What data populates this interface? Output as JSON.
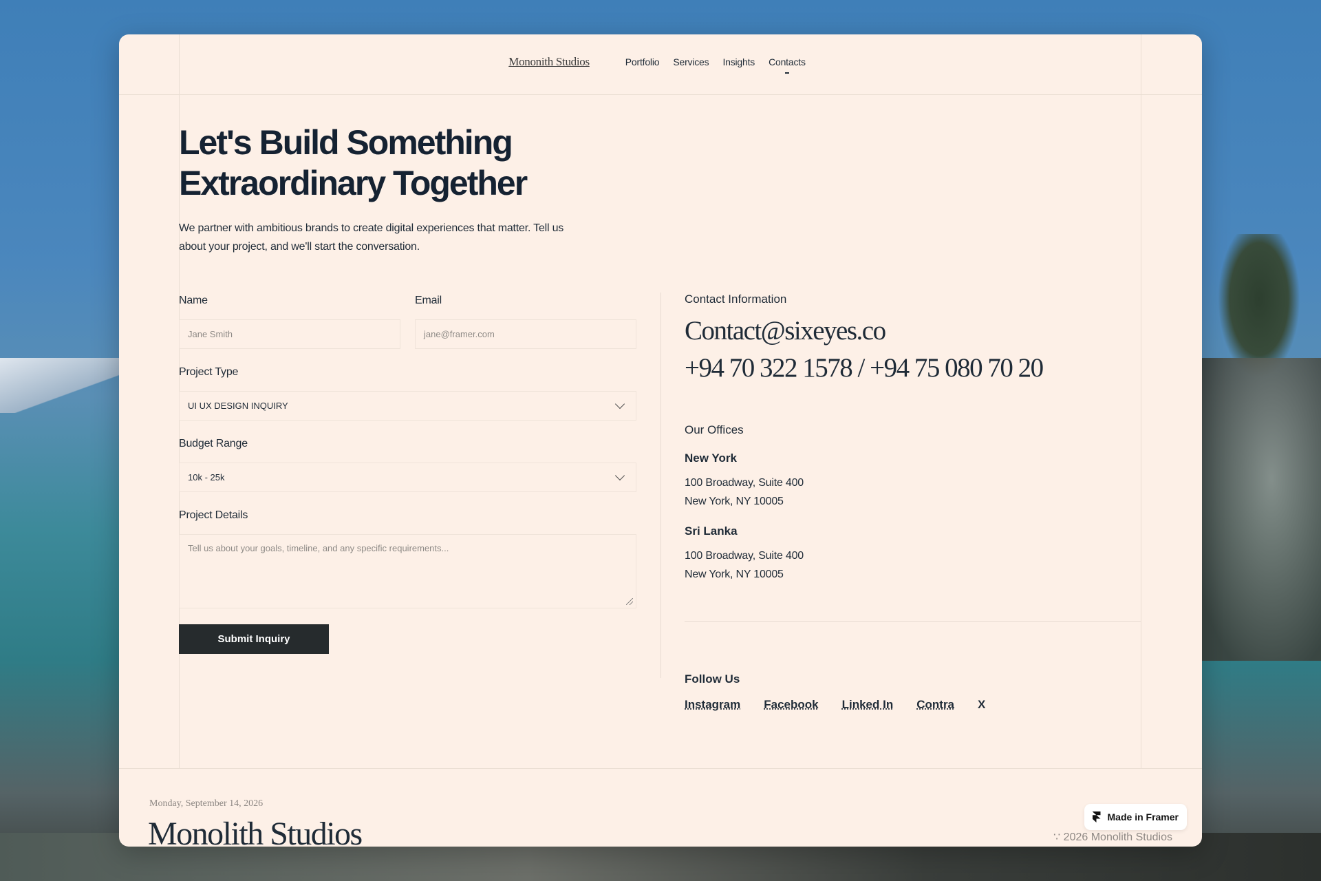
{
  "nav": {
    "brand": "Mononith Studios",
    "links": [
      "Portfolio",
      "Services",
      "Insights",
      "Contacts"
    ]
  },
  "hero": {
    "title_line1": "Let's Build Something",
    "title_line2": "Extraordinary Together",
    "subtitle": "We partner with ambitious brands to create digital experiences that matter. Tell us about your project, and we'll start the conversation."
  },
  "form": {
    "name_label": "Name",
    "name_placeholder": "Jane Smith",
    "email_label": "Email",
    "email_placeholder": "jane@framer.com",
    "project_type_label": "Project Type",
    "project_type_value": "UI UX DESIGN INQUIRY",
    "budget_label": "Budget Range",
    "budget_value": "10k - 25k",
    "details_label": "Project Details",
    "details_placeholder": "Tell us about your goals, timeline, and any specific requirements...",
    "submit_label": "Submit Inquiry"
  },
  "contact": {
    "heading": "Contact Information",
    "email": "Contact@sixeyes.co",
    "phones": "+94 70 322 1578 / +94 75 080 70 20",
    "offices_heading": "Our Offices",
    "offices": [
      {
        "city": "New York",
        "line1": "100 Broadway, Suite 400",
        "line2": "New York, NY 10005"
      },
      {
        "city": "Sri Lanka",
        "line1": "100 Broadway, Suite 400",
        "line2": "New York, NY 10005"
      }
    ],
    "follow_heading": "Follow Us",
    "socials": [
      "Instagram",
      "Facebook",
      "Linked In",
      "Contra",
      "X"
    ]
  },
  "footer": {
    "date": "Monday, September 14, 2026",
    "brand": "Monolith Studios",
    "copyright": "∵ 2026 Monolith Studios",
    "framer_badge": "Made in Framer"
  }
}
